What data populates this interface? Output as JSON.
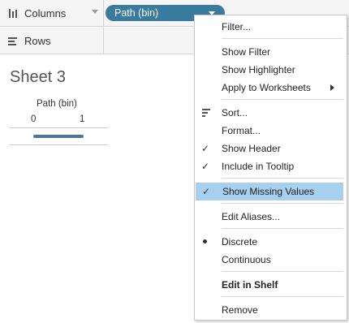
{
  "shelves": {
    "columns": {
      "label": "Columns",
      "icon": "columns-icon"
    },
    "rows": {
      "label": "Rows",
      "icon": "rows-icon"
    }
  },
  "pill": {
    "label": "Path (bin)",
    "color": "#3a7a9c"
  },
  "sheet": {
    "title": "Sheet 3",
    "axis_title": "Path (bin)",
    "ticks": [
      "0",
      "1"
    ],
    "mark_color": "#4e7a99"
  },
  "menu": {
    "filter": "Filter...",
    "show_filter": "Show Filter",
    "show_highlighter": "Show Highlighter",
    "apply_to_worksheets": "Apply to Worksheets",
    "sort": "Sort...",
    "format": "Format...",
    "show_header": "Show Header",
    "include_in_tooltip": "Include in Tooltip",
    "show_missing_values": "Show Missing Values",
    "edit_aliases": "Edit Aliases...",
    "discrete": "Discrete",
    "continuous": "Continuous",
    "edit_in_shelf": "Edit in Shelf",
    "remove": "Remove",
    "highlight_color": "#a7d0ed",
    "checkmark": "✓"
  }
}
